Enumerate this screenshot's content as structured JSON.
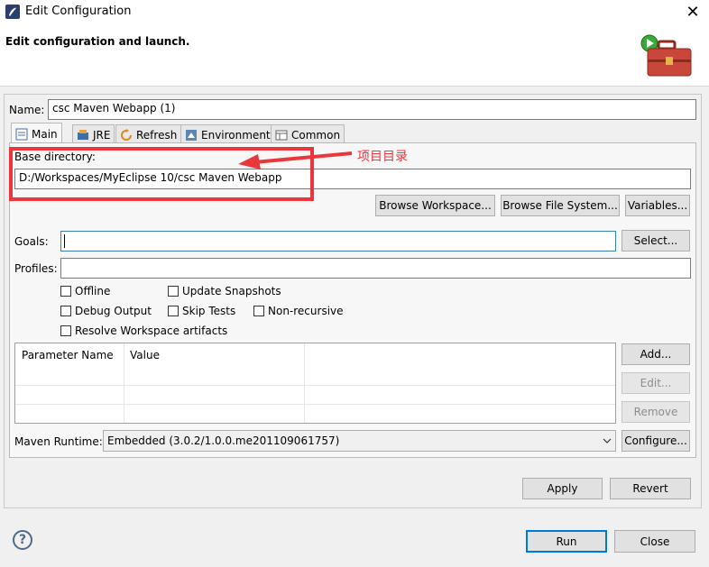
{
  "window": {
    "title": "Edit Configuration",
    "close_glyph": "✕"
  },
  "header": {
    "text": "Edit configuration and launch."
  },
  "name": {
    "label": "Name:",
    "value": "csc Maven Webapp (1)"
  },
  "tabs": [
    {
      "label": "Main",
      "icon": "main-tab-icon",
      "active": true
    },
    {
      "label": "JRE",
      "icon": "jre-icon"
    },
    {
      "label": "Refresh",
      "icon": "refresh-icon"
    },
    {
      "label": "Environment",
      "icon": "environment-icon"
    },
    {
      "label": "Common",
      "icon": "common-icon"
    }
  ],
  "base_dir": {
    "label": "Base directory:",
    "value": "D:/Workspaces/MyEclipse 10/csc Maven Webapp",
    "buttons": {
      "browse_workspace": "Browse Workspace...",
      "browse_fs": "Browse File System...",
      "variables": "Variables..."
    }
  },
  "annotation": {
    "text": "项目目录",
    "color": "#e8383d"
  },
  "goals": {
    "label": "Goals:",
    "value": "",
    "select_button": "Select..."
  },
  "profiles": {
    "label": "Profiles:",
    "value": ""
  },
  "checkboxes": {
    "offline": "Offline",
    "update_snapshots": "Update Snapshots",
    "debug_output": "Debug Output",
    "skip_tests": "Skip Tests",
    "non_recursive": "Non-recursive",
    "resolve_workspace": "Resolve Workspace artifacts"
  },
  "params_table": {
    "columns": [
      "Parameter Name",
      "Value"
    ],
    "buttons": {
      "add": "Add...",
      "edit": "Edit...",
      "remove": "Remove"
    }
  },
  "runtime": {
    "label": "Maven Runtime:",
    "value": "Embedded (3.0.2/1.0.0.me201109061757)",
    "configure_button": "Configure..."
  },
  "footer": {
    "apply": "Apply",
    "revert": "Revert",
    "run": "Run",
    "close": "Close",
    "help_glyph": "?"
  }
}
